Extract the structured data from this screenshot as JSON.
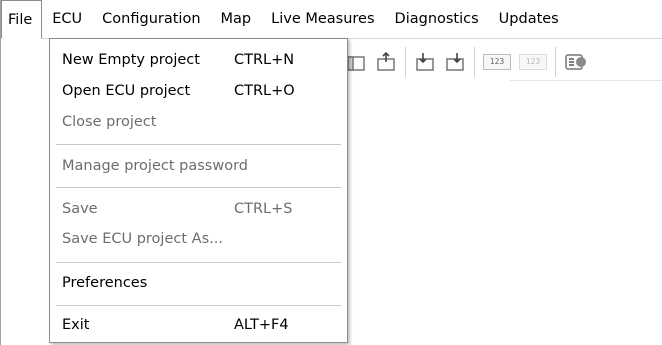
{
  "menubar": {
    "items": [
      {
        "label": "File"
      },
      {
        "label": "ECU"
      },
      {
        "label": "Configuration"
      },
      {
        "label": "Map"
      },
      {
        "label": "Live Measures"
      },
      {
        "label": "Diagnostics"
      },
      {
        "label": "Updates"
      }
    ]
  },
  "file_menu": {
    "new_empty_project": {
      "label": "New Empty project",
      "shortcut": "CTRL+N",
      "enabled": true
    },
    "open_ecu_project": {
      "label": "Open ECU project",
      "shortcut": "CTRL+O",
      "enabled": true
    },
    "close_project": {
      "label": "Close project",
      "enabled": false
    },
    "manage_password": {
      "label": "Manage project password",
      "enabled": false
    },
    "save": {
      "label": "Save",
      "shortcut": "CTRL+S",
      "enabled": false
    },
    "save_as": {
      "label": "Save ECU project As...",
      "enabled": false
    },
    "preferences": {
      "label": "Preferences",
      "enabled": true
    },
    "exit": {
      "label": "Exit",
      "shortcut": "ALT+F4",
      "enabled": true
    }
  },
  "toolbar": {
    "numbering_label": "123",
    "numbering_dim_label": "123",
    "icons": [
      "read-ecu-icon",
      "write-ecu-icon",
      "import-icon",
      "export-icon",
      "numbering-icon",
      "numbering-dim-icon",
      "live-data-icon"
    ]
  },
  "colors": {
    "disabled_text": "#6d6d6d",
    "menu_border": "#8c8c8c",
    "separator": "#c8c8c8"
  }
}
